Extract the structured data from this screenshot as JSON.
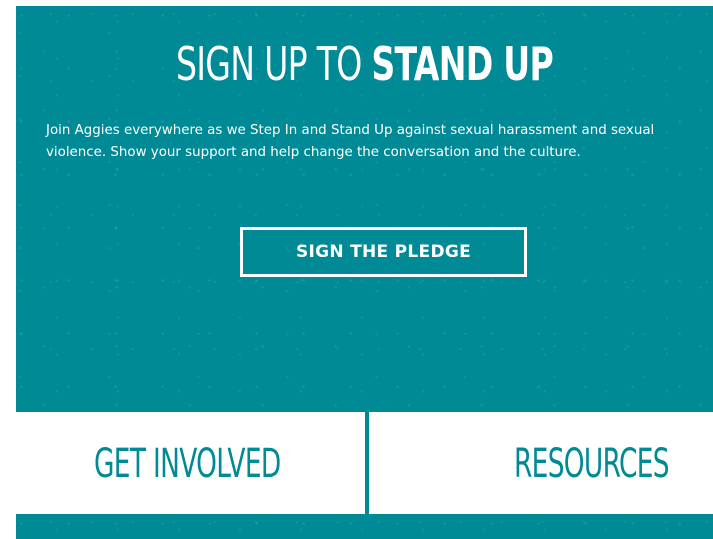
{
  "colors": {
    "brand_teal": "#008a96",
    "text_on_teal": "#ffffff",
    "background": "#ffffff"
  },
  "hero": {
    "title_light": "SIGN UP TO ",
    "title_bold": "STAND UP",
    "description": "Join Aggies everywhere as we Step In and Stand Up against sexual harassment and sexual violence. Show your support and help change the conversation and the culture.",
    "cta_label": "SIGN THE PLEDGE"
  },
  "links": {
    "get_involved": "GET INVOLVED",
    "resources": "RESOURCES"
  }
}
